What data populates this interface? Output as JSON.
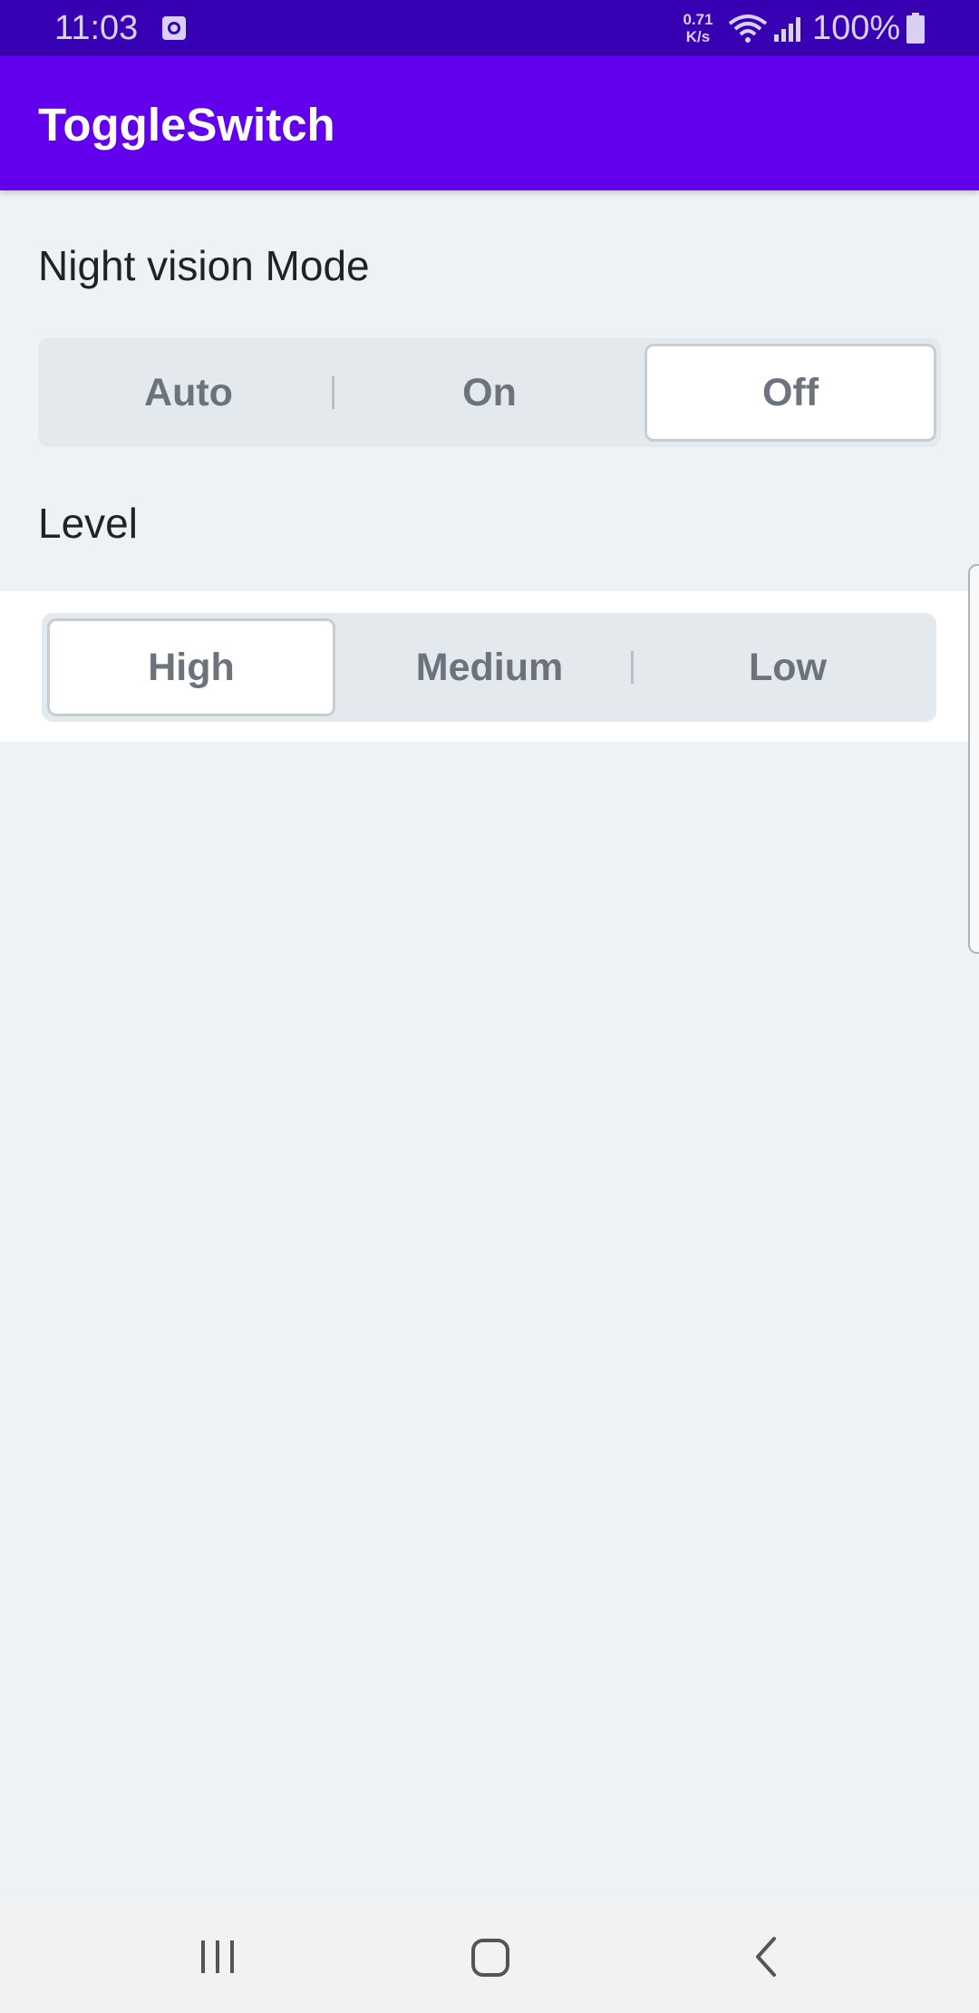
{
  "status_bar": {
    "time": "11:03",
    "speed_value": "0.71",
    "speed_unit": "K/s",
    "battery": "100%",
    "icons": [
      "clock-icon",
      "wifi-icon",
      "signal-icon",
      "battery-icon"
    ]
  },
  "app_bar": {
    "title": "ToggleSwitch"
  },
  "night_vision": {
    "label": "Night vision Mode",
    "options": [
      "Auto",
      "On",
      "Off"
    ],
    "selected": "Off"
  },
  "level": {
    "label": "Level",
    "options": [
      "High",
      "Medium",
      "Low"
    ],
    "selected": "High"
  },
  "nav_bar": {
    "icons": [
      "recents-icon",
      "home-icon",
      "back-icon"
    ]
  },
  "colors": {
    "status_bar": "#3700B3",
    "app_bar": "#6200EE",
    "background": "#EEF2F5",
    "segment_track": "#E4E9EE",
    "segment_selected": "#FFFFFF",
    "segment_text": "#6C737C"
  }
}
